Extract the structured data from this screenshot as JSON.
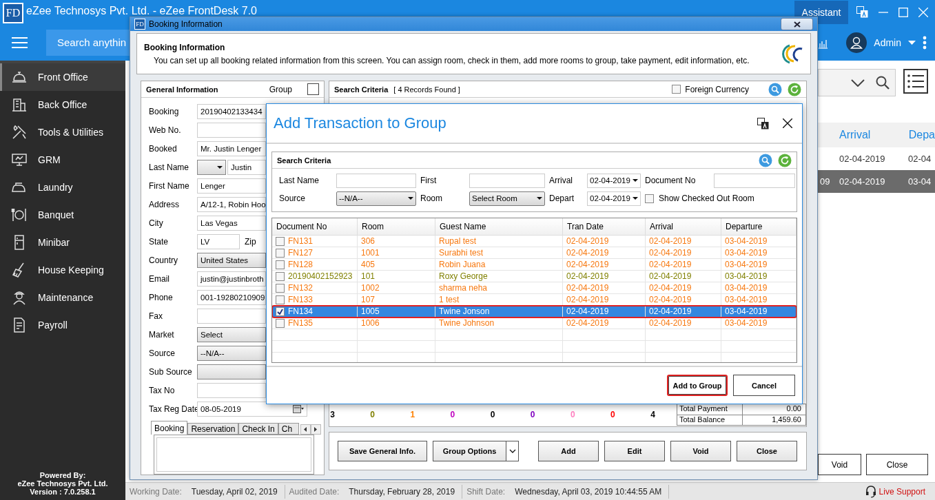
{
  "app": {
    "logo": "FD",
    "title": "eZee Technosys Pvt. Ltd. - eZee FrontDesk 7.0",
    "assistant": "Assistant",
    "search": {
      "placeholder": "Search anythin"
    },
    "user": "Admin"
  },
  "sidebar": {
    "items": [
      {
        "label": "Front Office",
        "selected": true
      },
      {
        "label": "Back Office",
        "selected": false
      },
      {
        "label": "Tools & Utilities",
        "selected": false
      },
      {
        "label": "GRM",
        "selected": false
      },
      {
        "label": "Laundry",
        "selected": false
      },
      {
        "label": "Banquet",
        "selected": false
      },
      {
        "label": "Minibar",
        "selected": false
      },
      {
        "label": "House Keeping",
        "selected": false
      },
      {
        "label": "Maintenance",
        "selected": false
      },
      {
        "label": "Payroll",
        "selected": false
      }
    ],
    "footer": [
      "Powered By:",
      "eZee Technosys Pvt. Ltd.",
      "Version : 7.0.258.1"
    ]
  },
  "background_list": {
    "columns": [
      "Arrival",
      "Depa"
    ],
    "rows": [
      {
        "cells": [
          "02-04-2019",
          "02-04"
        ],
        "selected": false
      },
      {
        "lead": "09",
        "cells": [
          "02-04-2019",
          "03-04"
        ],
        "selected": true
      }
    ],
    "buttons": [
      "Void",
      "Close"
    ]
  },
  "status_bar": {
    "items": [
      {
        "label": "Working Date:",
        "value": "Tuesday, April 02, 2019"
      },
      {
        "label": "Audited Date:",
        "value": "Thursday, February 28, 2019"
      },
      {
        "label": "Shift Date:",
        "value": "Wednesday, April 03, 2019 10:44:55 AM"
      }
    ],
    "live_support": "Live Support"
  },
  "booking_window": {
    "logo": "FD",
    "title": "Booking Information",
    "header": {
      "title": "Booking Information",
      "description": "You can set up all booking related information from this screen. You can assign room, check in them, add more rooms to group, take payment, edit information, etc."
    },
    "general": {
      "title": "General Information",
      "group": {
        "label": "Group",
        "checked": false
      },
      "fields": [
        {
          "label": "Booking",
          "kind": "text",
          "value": "20190402133434"
        },
        {
          "label": "Web No.",
          "kind": "text"
        },
        {
          "label": "Booked",
          "kind": "text",
          "value": "Mr. Justin Lenger"
        },
        {
          "label": "Last Name",
          "kind": "salutation",
          "value": "Justin"
        },
        {
          "label": "First Name",
          "kind": "text",
          "value": "Lenger"
        },
        {
          "label": "Address",
          "kind": "text",
          "value": "A/12-1, Robin Hoo"
        },
        {
          "label": "City",
          "kind": "text",
          "value": "Las Vegas"
        },
        {
          "label": "State",
          "kind": "state",
          "value": "LV",
          "extra_label": "Zip"
        },
        {
          "label": "Country",
          "kind": "select",
          "value": "United States"
        },
        {
          "label": "Email",
          "kind": "text",
          "value": "justin@justinbroth"
        },
        {
          "label": "Phone",
          "kind": "text",
          "value": "001-19280210909"
        },
        {
          "label": "Fax",
          "kind": "text"
        },
        {
          "label": "Market",
          "kind": "select",
          "value": "Select"
        },
        {
          "label": "Source",
          "kind": "select",
          "value": "--N/A--"
        },
        {
          "label": "Sub Source",
          "kind": "select"
        },
        {
          "label": "Tax No",
          "kind": "text"
        },
        {
          "label": "Tax Reg Date",
          "kind": "date",
          "value": "08-05-2019"
        }
      ],
      "tabs": [
        {
          "label": "Booking",
          "selected": true
        },
        {
          "label": "Reservation",
          "selected": false
        },
        {
          "label": "Check In",
          "selected": false
        },
        {
          "label": "Ch",
          "selected": false
        }
      ]
    },
    "search": {
      "title": "Search Criteria",
      "records": "[ 4 Records Found ]",
      "foreign_currency": {
        "label": "Foreign Currency",
        "checked": false
      }
    },
    "counts": [
      {
        "value": "3",
        "color": "#000000"
      },
      {
        "value": "0",
        "color": "#808000"
      },
      {
        "value": "1",
        "color": "#ff8000"
      },
      {
        "value": "0",
        "color": "#c000c0"
      },
      {
        "value": "0",
        "color": "#000000"
      },
      {
        "value": "0",
        "color": "#8000c0"
      },
      {
        "value": "0",
        "color": "#ff80c0"
      },
      {
        "value": "0",
        "color": "#ff0000"
      },
      {
        "value": "4",
        "color": "#000000"
      }
    ],
    "totals": [
      {
        "label": "Total Payment",
        "value": "0.00"
      },
      {
        "label": "Total Balance",
        "value": "1,459.60"
      }
    ],
    "buttons": [
      {
        "label": "Save General Info.",
        "kind": "button"
      },
      {
        "label": "Group Options",
        "kind": "split"
      },
      {
        "label": "Add",
        "kind": "button"
      },
      {
        "label": "Edit",
        "kind": "button"
      },
      {
        "label": "Void",
        "kind": "button"
      },
      {
        "label": "Close",
        "kind": "button"
      }
    ]
  },
  "modal": {
    "title": "Add Transaction to Group",
    "criteria": {
      "title": "Search Criteria",
      "fields": [
        {
          "label": "Last Name",
          "kind": "text"
        },
        {
          "label": "First",
          "kind": "text"
        },
        {
          "label": "Arrival",
          "kind": "date",
          "value": "02-04-2019"
        },
        {
          "label": "Document No",
          "kind": "text"
        },
        {
          "label": "Source",
          "kind": "select",
          "value": "--N/A--"
        },
        {
          "label": "Room",
          "kind": "select",
          "value": "Select Room"
        },
        {
          "label": "Depart",
          "kind": "date",
          "value": "02-04-2019"
        },
        {
          "label": "Show Checked Out Room",
          "kind": "checkbox",
          "checked": false
        }
      ]
    },
    "table": {
      "columns": [
        "Document No",
        "Room",
        "Guest Name",
        "Tran Date",
        "Arrival",
        "Departure"
      ],
      "rows": [
        {
          "checked": false,
          "selected": false,
          "color": "#f7780f",
          "cells": [
            "FN131",
            "306",
            "Rupal test",
            "02-04-2019",
            "02-04-2019",
            "03-04-2019"
          ]
        },
        {
          "checked": false,
          "selected": false,
          "color": "#f7780f",
          "cells": [
            "FN127",
            "1001",
            "Surabhi test",
            "02-04-2019",
            "02-04-2019",
            "03-04-2019"
          ]
        },
        {
          "checked": false,
          "selected": false,
          "color": "#f7780f",
          "cells": [
            "FN128",
            "405",
            "Robin Juana",
            "02-04-2019",
            "02-04-2019",
            "03-04-2019"
          ]
        },
        {
          "checked": false,
          "selected": false,
          "color": "#808000",
          "cells": [
            "20190402152923",
            "101",
            "Roxy George",
            "02-04-2019",
            "02-04-2019",
            "03-04-2019"
          ]
        },
        {
          "checked": false,
          "selected": false,
          "color": "#f7780f",
          "cells": [
            "FN132",
            "1002",
            "sharma neha",
            "02-04-2019",
            "02-04-2019",
            "03-04-2019"
          ]
        },
        {
          "checked": false,
          "selected": false,
          "color": "#f7780f",
          "cells": [
            "FN133",
            "107",
            "1 test",
            "02-04-2019",
            "02-04-2019",
            "03-04-2019"
          ]
        },
        {
          "checked": true,
          "selected": true,
          "cells": [
            "FN134",
            "1005",
            "Twine Jonson",
            "02-04-2019",
            "02-04-2019",
            "03-04-2019"
          ]
        },
        {
          "checked": false,
          "selected": false,
          "color": "#f7780f",
          "cells": [
            "FN135",
            "1006",
            "Twine Johnson",
            "02-04-2019",
            "02-04-2019",
            "03-04-2019"
          ]
        }
      ]
    },
    "buttons": [
      {
        "label": "Add to Group",
        "highlighted": true
      },
      {
        "label": "Cancel",
        "highlighted": false
      }
    ]
  }
}
